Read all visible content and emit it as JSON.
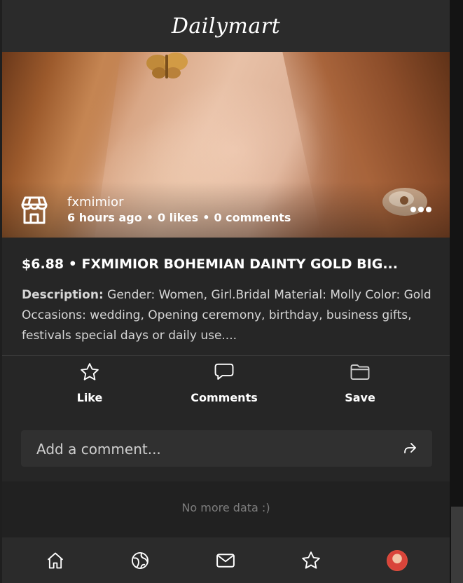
{
  "app": {
    "logo": "Dailymart"
  },
  "post": {
    "username": "fxmimior",
    "time_ago": "6 hours ago",
    "likes": "0 likes",
    "comments_count": "0 comments",
    "separator": "•",
    "title": "$6.88 • FXMIMIOR BOHEMIAN DAINTY GOLD BIG...",
    "description_label": "Description:",
    "description_text": "Gender: Women, Girl.Bridal Material: Molly Color: Gold Occasions: wedding, Opening ceremony, birthday, business gifts, festivals special days or daily use....",
    "icons": {
      "store": "store-icon",
      "more": "more-horizontal-icon"
    }
  },
  "actions": [
    {
      "label": "Like",
      "icon": "star-icon"
    },
    {
      "label": "Comments",
      "icon": "comment-icon"
    },
    {
      "label": "Save",
      "icon": "folder-icon"
    }
  ],
  "comment": {
    "placeholder": "Add a comment...",
    "send_icon": "share-icon"
  },
  "feed": {
    "end_message": "No more data :)"
  },
  "bottom_nav": [
    {
      "name": "home",
      "icon": "home-icon"
    },
    {
      "name": "explore",
      "icon": "globe-icon"
    },
    {
      "name": "messages",
      "icon": "mail-icon"
    },
    {
      "name": "favorites",
      "icon": "star-icon"
    },
    {
      "name": "profile",
      "icon": "avatar"
    }
  ],
  "colors": {
    "background": "#262626",
    "header": "#2b2b2b",
    "text": "#ffffff",
    "muted": "#7d7d7d",
    "input_bg": "#303030"
  }
}
